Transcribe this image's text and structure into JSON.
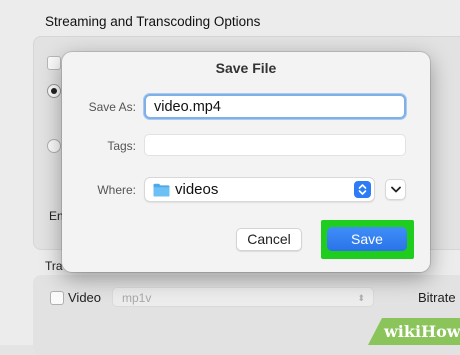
{
  "background": {
    "title": "Streaming and Transcoding Options",
    "enc_label": "En",
    "section2_label": "Tra",
    "video_label": "Video",
    "codec_value": "mp1v",
    "bitrate_label": "Bitrate"
  },
  "dialog": {
    "title": "Save File",
    "save_as_label": "Save As:",
    "save_as_value": "video.mp4",
    "tags_label": "Tags:",
    "tags_value": "",
    "where_label": "Where:",
    "where_value": "videos",
    "cancel_label": "Cancel",
    "save_label": "Save"
  },
  "icons": {
    "folder": "folder-icon",
    "stepper": "up-down-chevron-icon",
    "expand": "chevron-down-icon"
  },
  "colors": {
    "accent": "#2d7cf6",
    "highlight": "#1ecd1e",
    "watermark": "#8ac45a"
  },
  "watermark": {
    "wiki": "wiki",
    "how": "How"
  }
}
